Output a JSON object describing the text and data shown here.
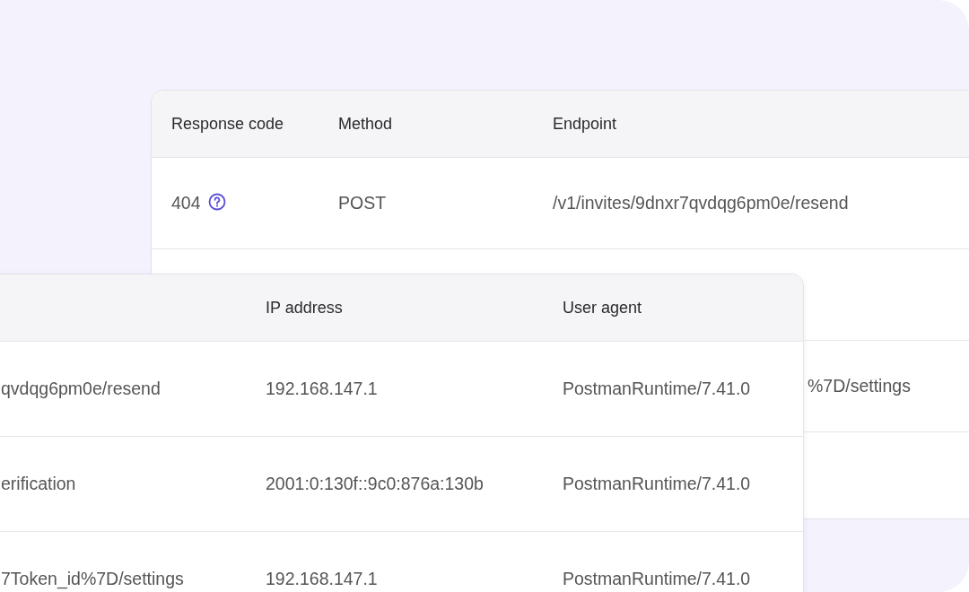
{
  "back_table": {
    "columns": [
      "Response code",
      "Method",
      "Endpoint"
    ],
    "rows": [
      {
        "response_code": "404",
        "help_icon": true,
        "method": "POST",
        "endpoint": "/v1/invites/9dnxr7qvdqg6pm0e/resend"
      },
      {},
      {
        "endpoint": "%7D/settings"
      },
      {}
    ]
  },
  "front_table": {
    "columns": [
      "IP address",
      "User agent"
    ],
    "rows": [
      {
        "column_1": "qvdqg6pm0e/resend",
        "ip_address": "192.168.147.1",
        "user_agent": "PostmanRuntime/7.41.0"
      },
      {
        "column_1": "erification",
        "ip_address": "2001:0:130f::9c0:876a:130b",
        "user_agent": "PostmanRuntime/7.41.0"
      },
      {
        "column_1": "7Token_id%7D/settings",
        "ip_address": "192.168.147.1",
        "user_agent": "PostmanRuntime/7.41.0"
      }
    ]
  }
}
